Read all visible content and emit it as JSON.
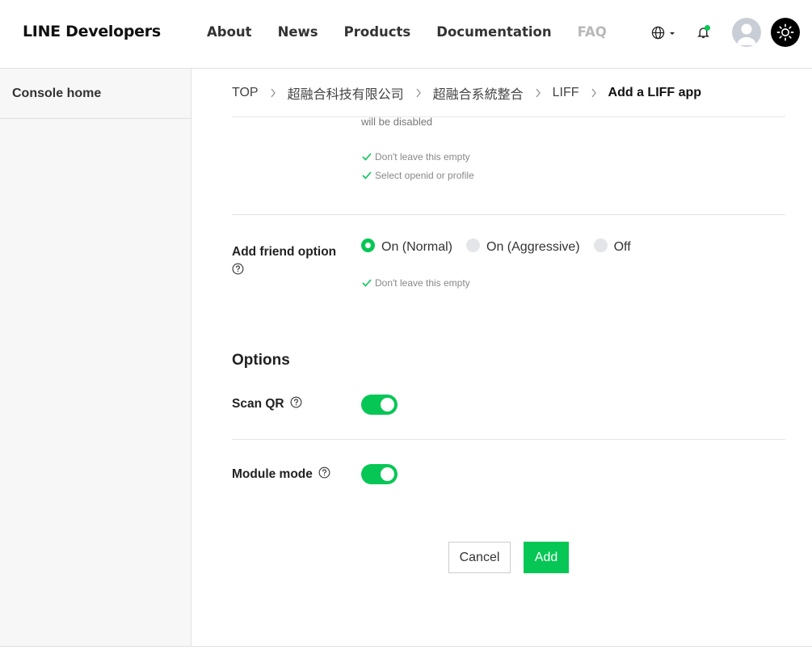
{
  "header": {
    "logo": "LINE Developers",
    "nav": [
      "About",
      "News",
      "Products",
      "Documentation",
      "FAQ"
    ]
  },
  "sidebar": {
    "items": [
      {
        "label": "Console home"
      }
    ]
  },
  "breadcrumb": [
    "TOP",
    "超融合科技有限公司",
    "超融合系統整合",
    "LIFF",
    "Add a LIFF app"
  ],
  "scopes": {
    "disabled_text": "will be disabled",
    "hints": [
      "Don't leave this empty",
      "Select openid or profile"
    ]
  },
  "add_friend": {
    "label": "Add friend option",
    "options": [
      "On (Normal)",
      "On (Aggressive)",
      "Off"
    ],
    "selected": "On (Normal)",
    "hint": "Don't leave this empty"
  },
  "options": {
    "title": "Options",
    "scan_qr": {
      "label": "Scan QR",
      "enabled": true
    },
    "module_mode": {
      "label": "Module mode",
      "enabled": true
    }
  },
  "buttons": {
    "cancel": "Cancel",
    "add": "Add"
  },
  "colors": {
    "accent": "#06c755"
  }
}
